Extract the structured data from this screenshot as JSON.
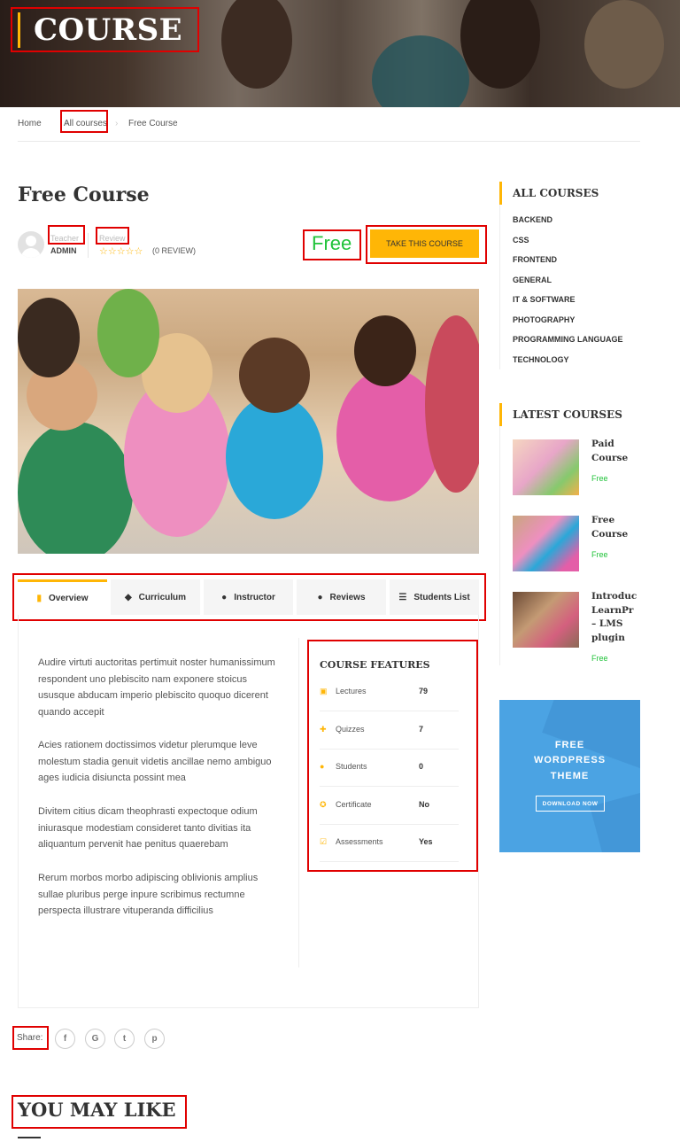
{
  "hero": {
    "title": "COURSE"
  },
  "breadcrumb": [
    "Home",
    "All courses",
    "Free Course"
  ],
  "course": {
    "title": "Free Course",
    "teacher_label": "Teacher",
    "teacher_name": "ADMIN",
    "review_label": "Review",
    "stars": "☆☆☆☆☆",
    "review_count": "(0 REVIEW)",
    "price": "Free",
    "cta": "TAKE THIS COURSE"
  },
  "tabs": [
    {
      "label": "Overview",
      "icon": "bookmark-icon",
      "active": true
    },
    {
      "label": "Curriculum",
      "icon": "cube-icon"
    },
    {
      "label": "Instructor",
      "icon": "user-icon"
    },
    {
      "label": "Reviews",
      "icon": "comments-icon"
    },
    {
      "label": "Students List",
      "icon": "list-icon"
    }
  ],
  "overview": [
    "Audire virtuti auctoritas pertimuit noster humanissimum respondent uno plebiscito nam exponere stoicus ususque abducam imperio plebiscito quoquo dicerent quando accepit",
    "Acies rationem doctissimos videtur plerumque leve molestum stadia genuit videtis ancillae nemo ambiguo ages iudicia disiuncta possint mea",
    "Divitem citius dicam theophrasti expectoque odium iniurasque modestiam consideret tanto divitias ita aliquantum pervenit hae penitus quaerebam",
    "Rerum morbos morbo adipiscing oblivionis amplius sullae pluribus perge inpure scribimus rectumne perspecta illustrare vituperanda difficilius"
  ],
  "features": {
    "title": "COURSE FEATURES",
    "rows": [
      {
        "label": "Lectures",
        "value": "79",
        "icon": "files-icon"
      },
      {
        "label": "Quizzes",
        "value": "7",
        "icon": "puzzle-icon"
      },
      {
        "label": "Students",
        "value": "0",
        "icon": "users-icon"
      },
      {
        "label": "Certificate",
        "value": "No",
        "icon": "certificate-icon"
      },
      {
        "label": "Assessments",
        "value": "Yes",
        "icon": "check-square-icon"
      }
    ]
  },
  "share": {
    "label": "Share:",
    "networks": [
      {
        "name": "facebook-icon",
        "glyph": "f"
      },
      {
        "name": "google-icon",
        "glyph": "G"
      },
      {
        "name": "twitter-icon",
        "glyph": "t"
      },
      {
        "name": "pinterest-icon",
        "glyph": "p"
      }
    ]
  },
  "related": {
    "title": "YOU MAY LIKE"
  },
  "sidebar": {
    "all_courses_title": "ALL COURSES",
    "categories": [
      "BACKEND",
      "CSS",
      "FRONTEND",
      "GENERAL",
      "IT & SOFTWARE",
      "PHOTOGRAPHY",
      "PROGRAMMING LANGUAGE",
      "TECHNOLOGY"
    ],
    "latest_title": "LATEST COURSES",
    "latest": [
      {
        "title": "Paid\nCourse",
        "price": "Free"
      },
      {
        "title": "Free\nCourse",
        "price": "Free"
      },
      {
        "title": "Introduc\nLearnPr\n– LMS\nplugin",
        "price": "Free"
      }
    ],
    "ad": {
      "line1": "FREE",
      "line2": "WORDPRESS",
      "line3": "THEME",
      "button": "DOWNLOAD NOW"
    }
  },
  "colors": {
    "accent": "#ffb606",
    "price": "#21c33a",
    "ad_bg": "#4ba3e3"
  }
}
